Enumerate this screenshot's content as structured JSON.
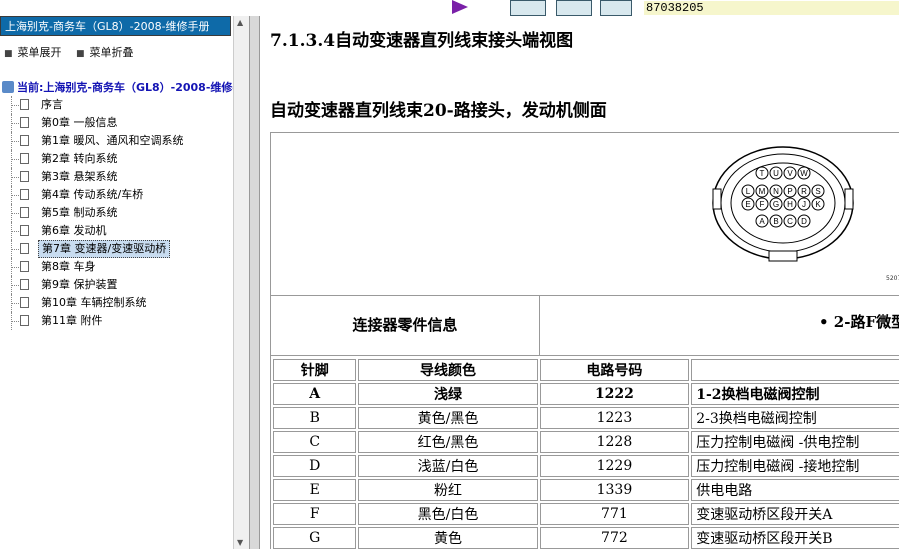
{
  "toolbar": {
    "doc_id": "87038205"
  },
  "left_pane": {
    "title": "上海别克-商务车（GL8）-2008-维修手册",
    "expand_label": "菜单展开",
    "collapse_label": "菜单折叠",
    "current": "当前:上海别克-商务车（GL8）-2008-维修手册",
    "tree": [
      {
        "label": "序言"
      },
      {
        "label": "第0章 一般信息"
      },
      {
        "label": "第1章 暖风、通风和空调系统"
      },
      {
        "label": "第2章 转向系统"
      },
      {
        "label": "第3章 悬架系统"
      },
      {
        "label": "第4章 传动系统/车桥"
      },
      {
        "label": "第5章 制动系统"
      },
      {
        "label": "第6章 发动机"
      },
      {
        "label": "第7章 变速器/变速驱动桥",
        "selected": true
      },
      {
        "label": "第8章 车身"
      },
      {
        "label": "第9章 保护装置"
      },
      {
        "label": "第10章 车辆控制系统"
      },
      {
        "label": "第11章 附件"
      }
    ]
  },
  "main": {
    "section_title": "7.1.3.4自动变速器直列线束接头端视图",
    "connector_title": "自动变速器直列线束20-路接头，发动机侧面",
    "image_number": "5207",
    "connector_pins": [
      [
        "T",
        "U",
        "V",
        "W"
      ],
      [
        "L",
        "M",
        "N",
        "P",
        "R",
        "S"
      ],
      [
        "E",
        "F",
        "G",
        "H",
        "J",
        "K"
      ],
      [
        "A",
        "B",
        "C",
        "D"
      ]
    ],
    "info_label": "连接器零件信息",
    "info_desc": "• 2-路F微型",
    "table": {
      "headers": [
        "针脚",
        "导线颜色",
        "电路号码",
        ""
      ],
      "rows": [
        {
          "pin": "A",
          "color": "浅绿",
          "circuit": "1222",
          "function": "1-2换档电磁阀控制"
        },
        {
          "pin": "B",
          "color": "黄色/黑色",
          "circuit": "1223",
          "function": "2-3换档电磁阀控制"
        },
        {
          "pin": "C",
          "color": "红色/黑色",
          "circuit": "1228",
          "function": "压力控制电磁阀 -供电控制"
        },
        {
          "pin": "D",
          "color": "浅蓝/白色",
          "circuit": "1229",
          "function": "压力控制电磁阀 -接地控制"
        },
        {
          "pin": "E",
          "color": "粉红",
          "circuit": "1339",
          "function": "供电电路"
        },
        {
          "pin": "F",
          "color": "黑色/白色",
          "circuit": "771",
          "function": "变速驱动桥区段开关A"
        },
        {
          "pin": "G",
          "color": "黄色",
          "circuit": "772",
          "function": "变速驱动桥区段开关B"
        }
      ]
    }
  }
}
